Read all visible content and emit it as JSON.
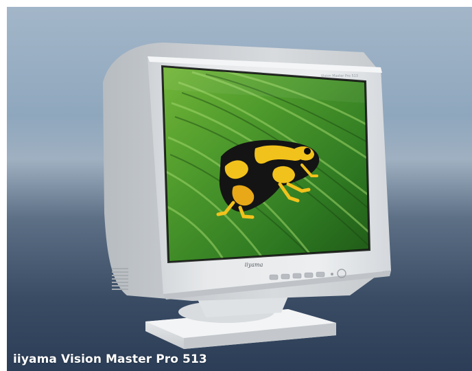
{
  "photo": {
    "caption": "iiyama Vision Master Pro 513",
    "bezel_brand": "iiyama",
    "bezel_model": "Vision Master Pro 513",
    "subject": "CRT monitor displaying a poison dart frog on a green leaf",
    "colors": {
      "backdrop_top": "#8fa7bd",
      "backdrop_bottom": "#2c3e57",
      "monitor_casing": "#e6e8ea",
      "leaf_green": "#3f8a2a",
      "frog_yellow": "#f2c21c",
      "frog_black": "#141414"
    }
  }
}
